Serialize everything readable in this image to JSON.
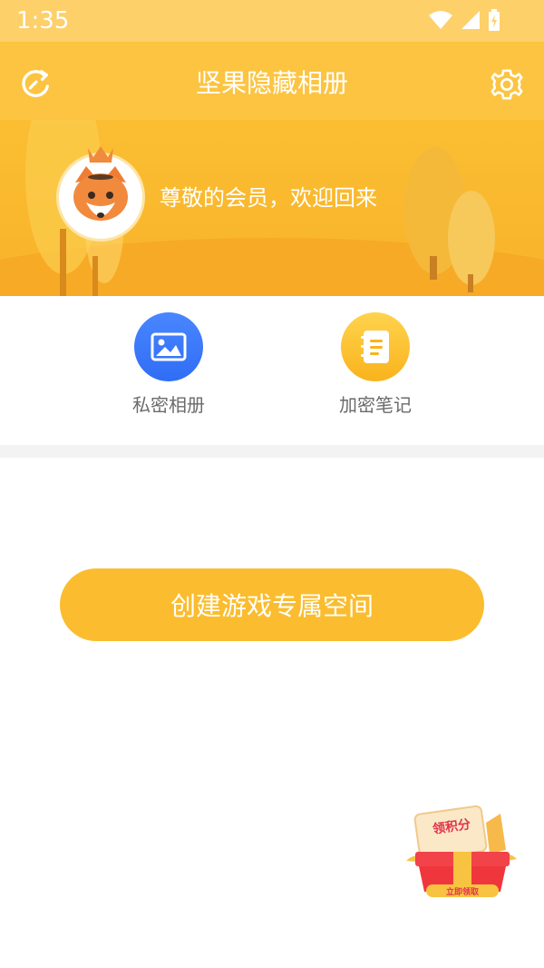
{
  "status_bar": {
    "time": "1:35"
  },
  "header": {
    "title": "坚果隐藏相册",
    "refresh_icon": "refresh-icon",
    "settings_icon": "gear-icon"
  },
  "banner": {
    "welcome": "尊敬的会员，欢迎回来",
    "avatar_icon": "fox-avatar-icon"
  },
  "actions": [
    {
      "label": "私密相册",
      "icon": "image-icon",
      "color": "#2f6df5"
    },
    {
      "label": "加密笔记",
      "icon": "notebook-icon",
      "color": "#f9b31c"
    }
  ],
  "main": {
    "create_button_label": "创建游戏专属空间"
  },
  "promo": {
    "title": "领积分",
    "cta": "立即领取"
  },
  "colors": {
    "accent": "#fbbd2f",
    "status_bar": "#fdd06a",
    "header": "#fcc441"
  }
}
